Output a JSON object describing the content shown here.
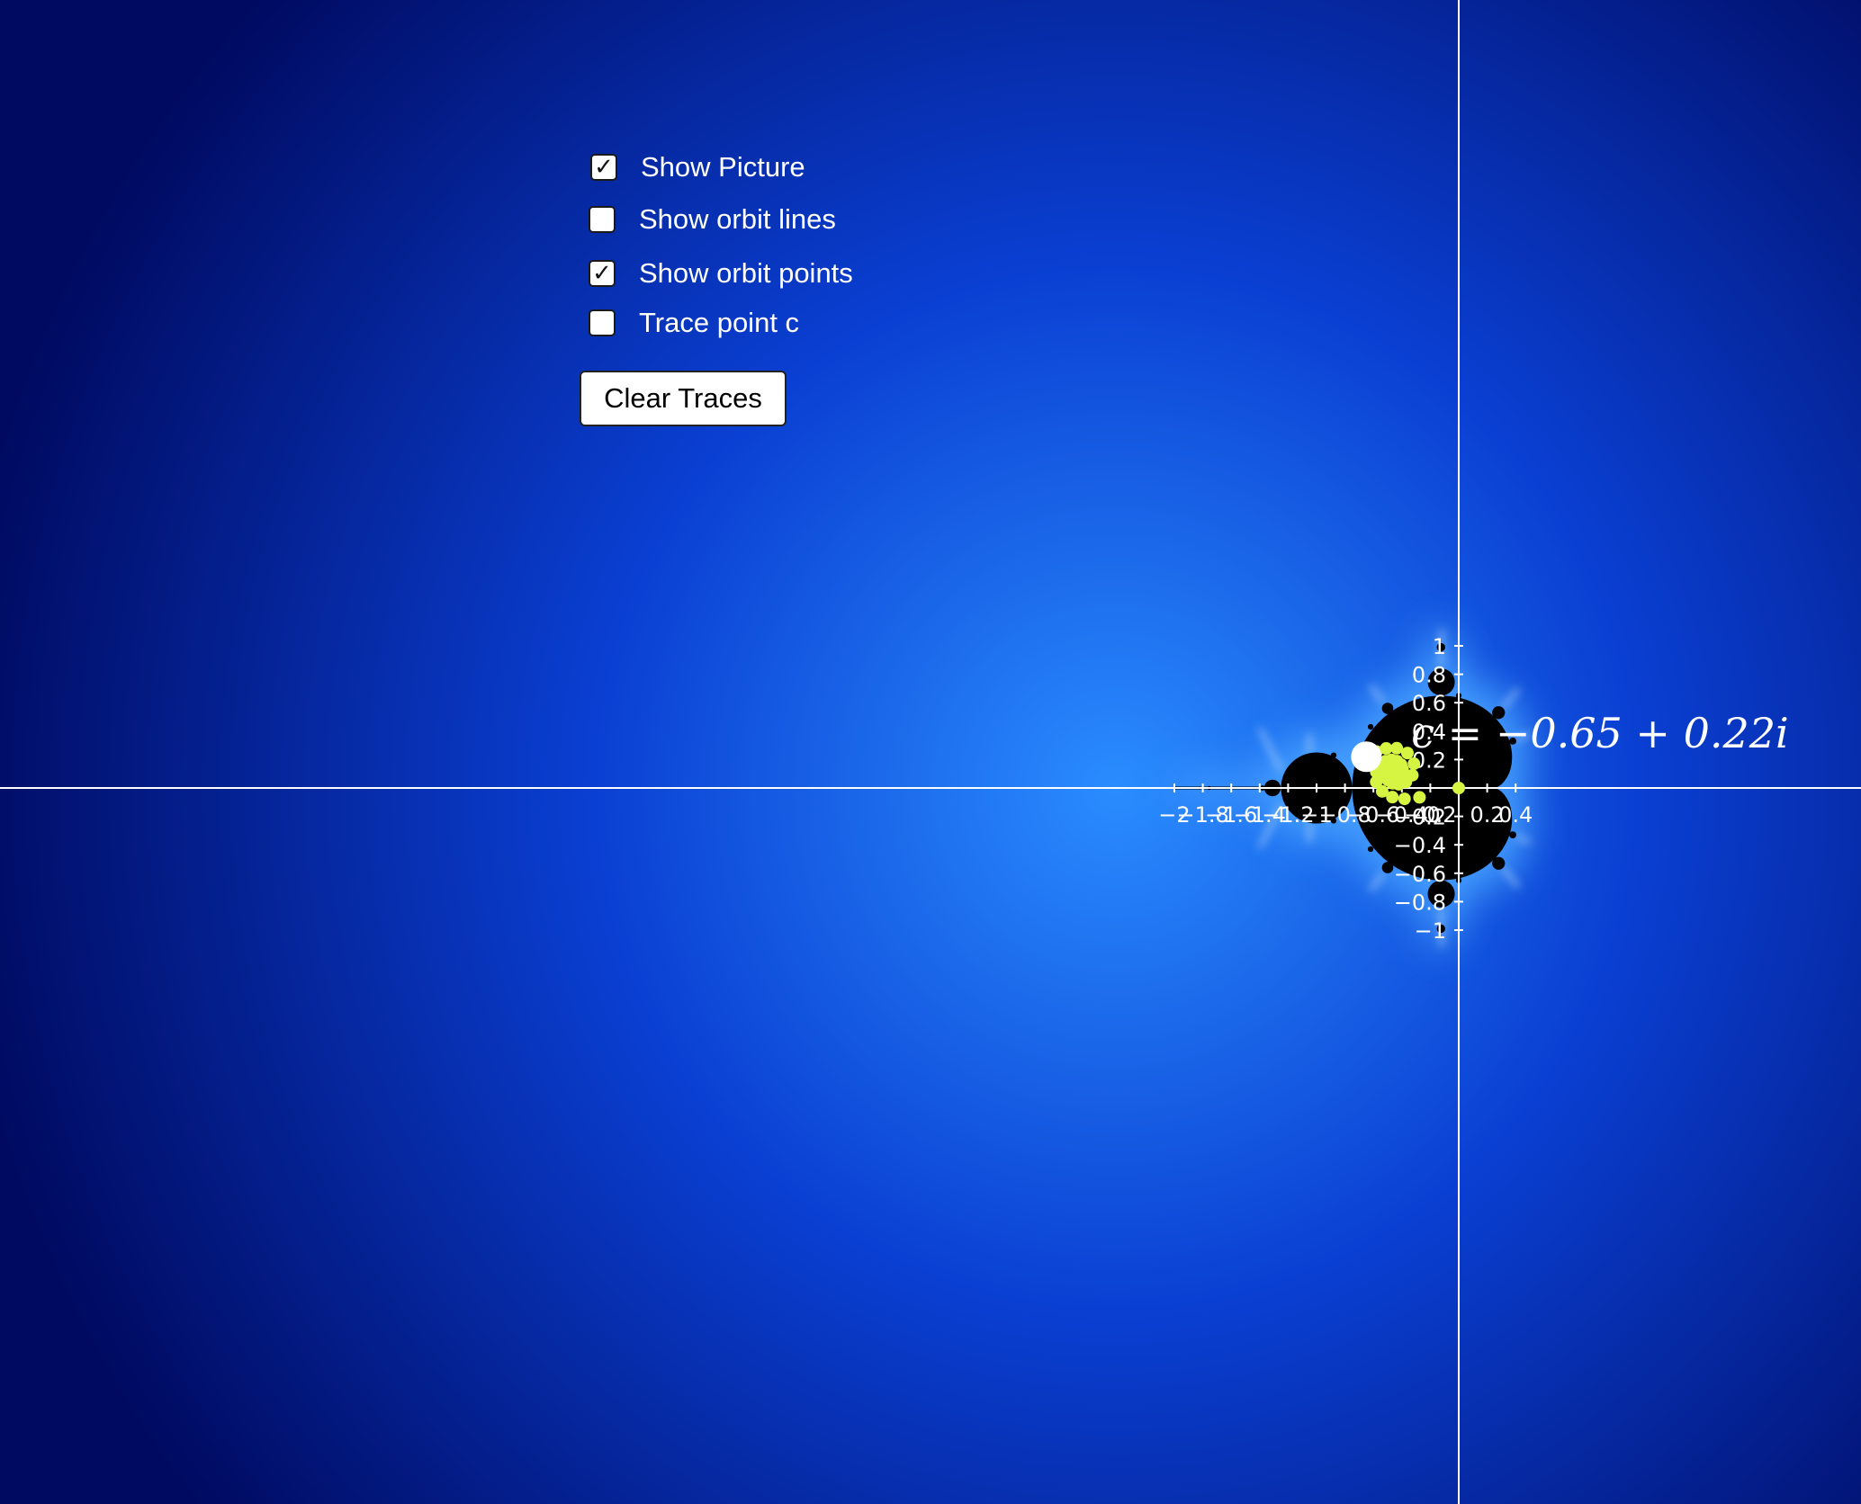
{
  "controls": {
    "show_picture": {
      "label": "Show Picture",
      "checked": true
    },
    "show_orbit_lines": {
      "label": "Show orbit lines",
      "checked": false
    },
    "show_orbit_points": {
      "label": "Show orbit points",
      "checked": true
    },
    "trace_point_c": {
      "label": "Trace point c",
      "checked": false
    },
    "clear_traces_label": "Clear Traces"
  },
  "point_c": {
    "re": -0.65,
    "im": 0.22,
    "label": "c = −0.65 + 0.22i"
  },
  "axes": {
    "x_range": [
      -2.05,
      0.55
    ],
    "y_range": [
      -1.0,
      1.1
    ],
    "x_ticks": [
      {
        "v": -2,
        "t": "−2"
      },
      {
        "v": -1.8,
        "t": "−1.8"
      },
      {
        "v": -1.6,
        "t": "−1.6"
      },
      {
        "v": -1.4,
        "t": "−1.4"
      },
      {
        "v": -1.2,
        "t": "−1.2"
      },
      {
        "v": -1,
        "t": "−1"
      },
      {
        "v": -0.8,
        "t": "−0.8"
      },
      {
        "v": -0.6,
        "t": "−0.6"
      },
      {
        "v": -0.4,
        "t": "−0.4"
      },
      {
        "v": -0.2,
        "t": "−0.2"
      },
      {
        "v": 0,
        "t": "0"
      },
      {
        "v": 0.2,
        "t": "0.2"
      },
      {
        "v": 0.4,
        "t": "0.4"
      }
    ],
    "y_ticks": [
      {
        "v": 1,
        "t": "1"
      },
      {
        "v": 0.8,
        "t": "0.8"
      },
      {
        "v": 0.6,
        "t": "0.6"
      },
      {
        "v": 0.4,
        "t": "0.4"
      },
      {
        "v": 0.2,
        "t": "0.2"
      },
      {
        "v": -0.2,
        "t": "−0.2"
      },
      {
        "v": -0.4,
        "t": "−0.4"
      },
      {
        "v": -0.6,
        "t": "−0.6"
      },
      {
        "v": -0.8,
        "t": "−0.8"
      },
      {
        "v": -1,
        "t": "−1"
      }
    ]
  },
  "colors": {
    "background": "#000c6e",
    "glow": "#1e64e6",
    "set": "#000000",
    "orbit_points": "#d6f542",
    "axes": "#ffffff",
    "point_c": "#ffffff"
  }
}
